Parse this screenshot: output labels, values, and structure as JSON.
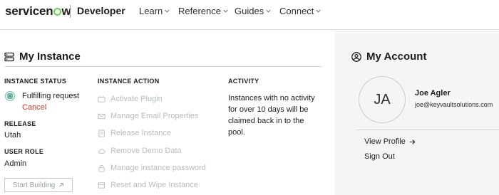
{
  "header": {
    "brand": [
      "servicen",
      "w"
    ],
    "product": "Developer",
    "nav": [
      "Learn",
      "Reference",
      "Guides",
      "Connect"
    ]
  },
  "instance": {
    "title": "My Instance",
    "status_heading": "INSTANCE STATUS",
    "status_value": "Fulfilling request",
    "cancel_label": "Cancel",
    "release_heading": "RELEASE",
    "release_value": "Utah",
    "role_heading": "USER ROLE",
    "role_value": "Admin",
    "start_building_label": "Start Building",
    "action_heading": "INSTANCE ACTION",
    "actions": [
      "Activate Plugin",
      "Manage Email Properties",
      "Release Instance",
      "Remove Demo Data",
      "Manage instance password",
      "Reset and Wipe Instance"
    ],
    "activity_heading": "ACTIVITY",
    "activity_text": "Instances with no activity for over 10 days will be claimed back in to the pool."
  },
  "account": {
    "title": "My Account",
    "initials": "JA",
    "name": "Joe Agler",
    "email": "joe@keyvaultsolutions.com",
    "view_profile": "View Profile",
    "sign_out": "Sign Out"
  },
  "colors": {
    "brand_green": "#62d84e",
    "cancel_red": "#c0392b",
    "disabled_gray": "#b7bbbf",
    "account_bg": "#f4f5f6"
  }
}
